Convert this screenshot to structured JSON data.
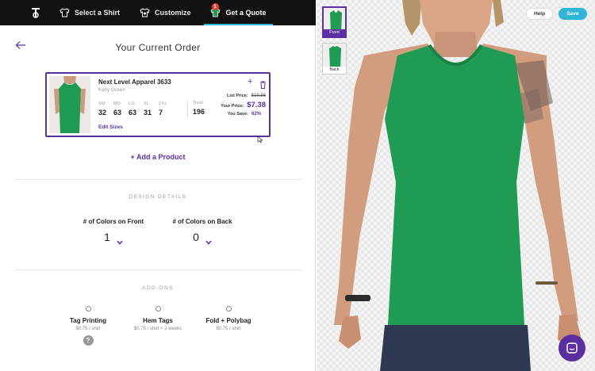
{
  "nav": {
    "logo_icon": "tee-logo-icon",
    "tabs": [
      {
        "label": "Select a Shirt",
        "icon": "shirt-icon"
      },
      {
        "label": "Customize",
        "icon": "palette-icon"
      },
      {
        "label": "Get a Quote",
        "icon": "quote-icon",
        "badge": "1"
      }
    ]
  },
  "order": {
    "title": "Your Current Order",
    "product_name": "Next Level Apparel 3633",
    "product_color": "Kelly Green",
    "sizes": [
      {
        "label": "SM",
        "qty": "32"
      },
      {
        "label": "MD",
        "qty": "63"
      },
      {
        "label": "LG",
        "qty": "63"
      },
      {
        "label": "XL",
        "qty": "31"
      },
      {
        "label": "2XL",
        "qty": "7"
      }
    ],
    "total_label": "Total",
    "total_qty": "196",
    "edit_sizes": "Edit Sizes",
    "list_price_label": "List Price:",
    "list_price": "$19.56",
    "your_price_label": "Your Price:",
    "your_price": "$7.38",
    "you_save_label": "You Save:",
    "you_save": "62%",
    "add_product": "+ Add a Product"
  },
  "design": {
    "section_title": "DESIGN DETAILS",
    "front_label": "# of Colors on Front",
    "front_value": "1",
    "back_label": "# of Colors on Back",
    "back_value": "0"
  },
  "addons": {
    "section_title": "ADD-ONS",
    "items": [
      {
        "name": "Tag Printing",
        "price": "$0.75 / shirt"
      },
      {
        "name": "Hem Tags",
        "price": "$0.75 / shirt + 2 weeks"
      },
      {
        "name": "Fold + Polybag",
        "price": "$0.75 / shirt"
      }
    ],
    "help": "?"
  },
  "preview": {
    "views": [
      {
        "label": "Front",
        "active": true
      },
      {
        "label": "Back",
        "active": false
      }
    ],
    "help_label": "Help",
    "save_label": "Save",
    "shirt_color": "#1f9b53"
  },
  "colors": {
    "accent": "#5b2fa0",
    "save": "#2fb5d8",
    "shirt": "#1f9b53"
  }
}
